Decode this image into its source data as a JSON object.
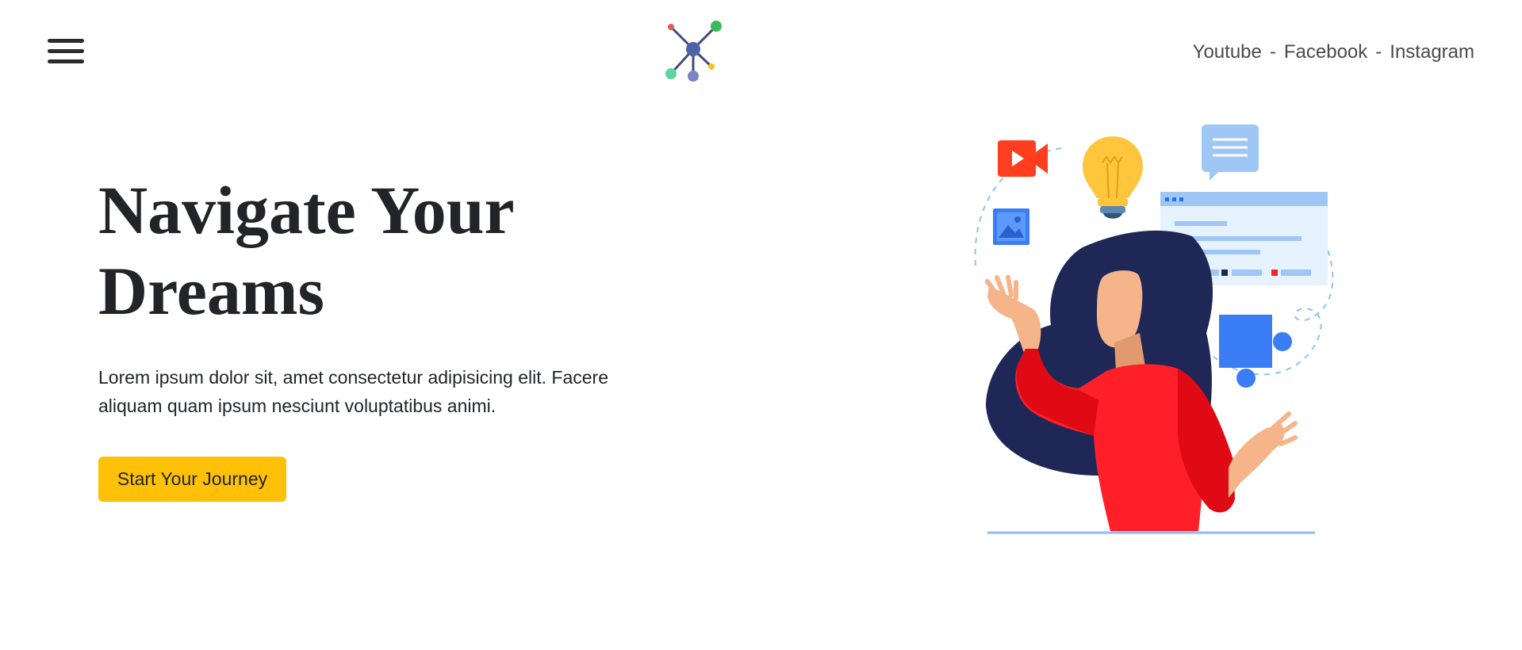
{
  "header": {
    "menu_icon": "hamburger-menu-icon",
    "logo_icon": "network-nodes-logo",
    "social": {
      "youtube": "Youtube",
      "facebook": "Facebook",
      "instagram": "Instagram",
      "separator": "-"
    }
  },
  "hero": {
    "title_line1": "Navigate Your",
    "title_line2": "Dreams",
    "description": "Lorem ipsum dolor sit, amet consectetur adipisicing elit. Facere aliquam quam ipsum nesciunt voluptatibus animi.",
    "cta_label": "Start Your Journey"
  },
  "illustration": {
    "subject": "woman-with-floating-ideas-illustration",
    "icons": [
      "video-camera-icon",
      "lightbulb-icon",
      "chat-bubble-icon",
      "image-icon",
      "browser-window-icon",
      "puzzle-piece-icon"
    ]
  },
  "colors": {
    "accent": "#ffc107",
    "text_dark": "#212529",
    "illustration_red": "#ff1f28",
    "illustration_navy": "#1f2757",
    "illustration_blue": "#3b7df5"
  }
}
